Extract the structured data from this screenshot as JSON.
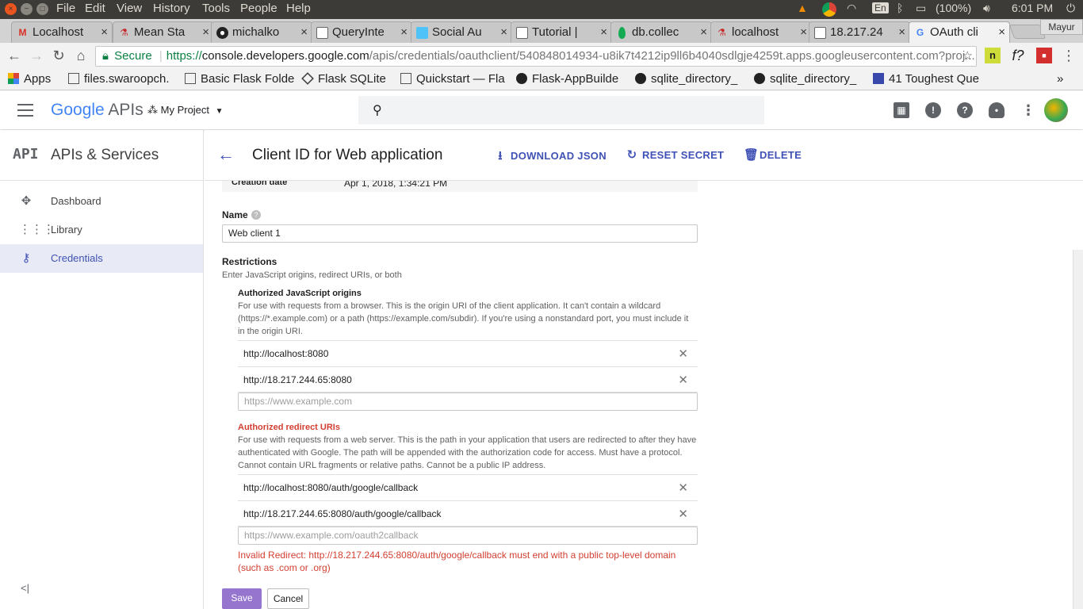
{
  "os": {
    "menu": [
      "File",
      "Edit",
      "View",
      "History",
      "Tools",
      "People",
      "Help"
    ],
    "battery": "(100%)",
    "keyboard": "En",
    "clock": "6:01 PM",
    "user": "Mayur"
  },
  "tabs": [
    {
      "title": "Localhost",
      "icon": "gmail-icon"
    },
    {
      "title": "Mean Sta",
      "icon": "flask-icon"
    },
    {
      "title": "michalko",
      "icon": "github-icon"
    },
    {
      "title": "QueryInte",
      "icon": "doc-icon"
    },
    {
      "title": "Social Au",
      "icon": "cube-icon"
    },
    {
      "title": "Tutorial |",
      "icon": "doc-icon"
    },
    {
      "title": "db.collec",
      "icon": "mongo-icon"
    },
    {
      "title": "localhost",
      "icon": "flask-icon"
    },
    {
      "title": "18.217.24",
      "icon": "doc-icon"
    },
    {
      "title": "OAuth cli",
      "icon": "google-icon",
      "active": true
    }
  ],
  "address": {
    "secure_label": "Secure",
    "url_scheme": "https://",
    "url_host": "console.developers.google.com",
    "url_path": "/apis/credentials/oauthclient/540848014934-u8ik7t4212ip9ll6b4040sdlgje4259t.apps.googleusercontent.com?proj..."
  },
  "bookmarks": [
    "Apps",
    "files.swaroopch.",
    "Basic Flask Folde",
    "Flask SQLite",
    "Quickstart — Fla",
    "Flask-AppBuilde",
    "sqlite_directory_",
    "sqlite_directory_",
    "41 Toughest Que"
  ],
  "header": {
    "logo_google": "Google",
    "logo_apis": "APIs",
    "project": "My Project"
  },
  "sidebar": {
    "title_icon": "API",
    "title": "APIs & Services",
    "items": [
      {
        "label": "Dashboard",
        "icon": "dashboard-icon"
      },
      {
        "label": "Library",
        "icon": "library-icon"
      },
      {
        "label": "Credentials",
        "icon": "key-icon",
        "active": true
      }
    ]
  },
  "page": {
    "title": "Client ID for Web application",
    "actions": {
      "download": "DOWNLOAD JSON",
      "reset": "RESET SECRET",
      "delete": "DELETE"
    },
    "creation_label": "Creation date",
    "creation_value": "Apr 1, 2018, 1:34:21 PM",
    "name_label": "Name",
    "name_value": "Web client 1",
    "restrictions_title": "Restrictions",
    "restrictions_desc": "Enter JavaScript origins, redirect URIs, or both",
    "origins": {
      "title": "Authorized JavaScript origins",
      "desc_lines": [
        "For use with requests from a browser. This is the origin URI of the client application. It can't contain a wildcard",
        "(https://*.example.com) or a path (https://example.com/subdir). If you're using a nonstandard port, you must include it",
        "in the origin URI."
      ],
      "uris": [
        "http://localhost:8080",
        "http://18.217.244.65:8080"
      ],
      "placeholder": "https://www.example.com"
    },
    "redirects": {
      "title": "Authorized redirect URIs",
      "desc_lines": [
        "For use with requests from a web server. This is the path in your application that users are redirected to after they have",
        "authenticated with Google. The path will be appended with the authorization code for access. Must have a protocol.",
        "Cannot contain URL fragments or relative paths. Cannot be a public IP address."
      ],
      "uris": [
        "http://localhost:8080/auth/google/callback",
        "http://18.217.244.65:8080/auth/google/callback"
      ],
      "placeholder": "https://www.example.com/oauth2callback",
      "error_lines": [
        "Invalid Redirect: http://18.217.244.65:8080/auth/google/callback must end with a public top-level domain",
        "(such as .com or .org)"
      ]
    },
    "save": "Save",
    "cancel": "Cancel"
  },
  "colors": {
    "accent": "#3f51b5",
    "error": "#d23f31",
    "secure": "#0b8043",
    "save_bg": "#9575cd"
  }
}
